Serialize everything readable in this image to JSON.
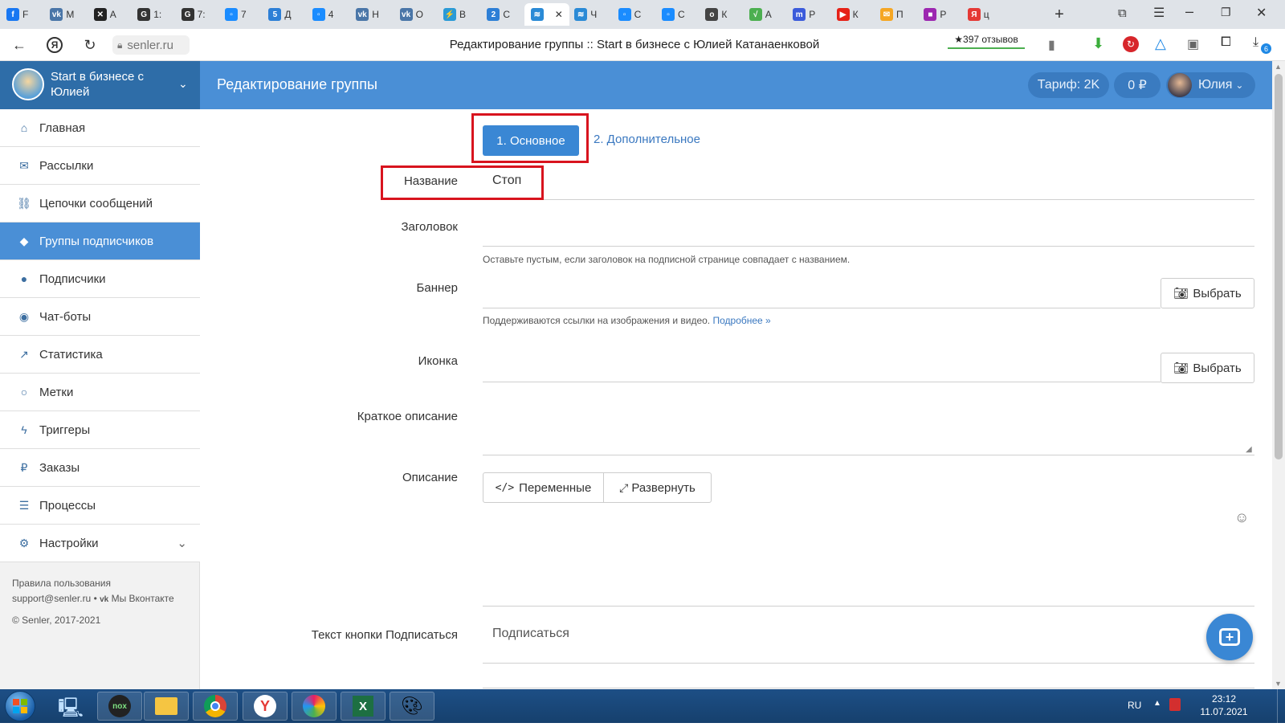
{
  "tabs": [
    {
      "label": "F",
      "icon": "facebook-icon",
      "color": "#1877f2",
      "glyph": "f"
    },
    {
      "label": "M",
      "icon": "vk-icon",
      "color": "#4a76a8",
      "glyph": "vk"
    },
    {
      "label": "A",
      "icon": "x-app-icon",
      "color": "#222",
      "glyph": "✕"
    },
    {
      "label": "1:",
      "icon": "gc-icon",
      "color": "#333",
      "glyph": "G"
    },
    {
      "label": "7:",
      "icon": "gc-icon",
      "color": "#333",
      "glyph": "G"
    },
    {
      "label": "7",
      "icon": "chat-icon",
      "color": "#1a8cff",
      "glyph": "▫"
    },
    {
      "label": "Д",
      "icon": "number5-icon",
      "color": "#2d7fd6",
      "glyph": "5"
    },
    {
      "label": "4",
      "icon": "chat-icon",
      "color": "#1a8cff",
      "glyph": "▫"
    },
    {
      "label": "Н",
      "icon": "vk-icon",
      "color": "#4a76a8",
      "glyph": "vk"
    },
    {
      "label": "О",
      "icon": "vk-icon",
      "color": "#4a76a8",
      "glyph": "vk"
    },
    {
      "label": "В",
      "icon": "runner-icon",
      "color": "#2a9ad6",
      "glyph": "⚡"
    },
    {
      "label": "С",
      "icon": "number2-icon",
      "color": "#2d7fd6",
      "glyph": "2"
    },
    {
      "label": "",
      "icon": "senler-icon",
      "color": "#2a8ad6",
      "glyph": "≋"
    },
    {
      "label": "Ч",
      "icon": "senler-icon",
      "color": "#2a8ad6",
      "glyph": "≋"
    },
    {
      "label": "С",
      "icon": "chat-icon",
      "color": "#1a8cff",
      "glyph": "▫"
    },
    {
      "label": "С",
      "icon": "chat-icon",
      "color": "#1a8cff",
      "glyph": "▫"
    },
    {
      "label": "К",
      "icon": "circle-icon",
      "color": "#444",
      "glyph": "o"
    },
    {
      "label": "А",
      "icon": "check-icon",
      "color": "#4caf50",
      "glyph": "√"
    },
    {
      "label": "Р",
      "icon": "m-app-icon",
      "color": "#3b5bdb",
      "glyph": "m"
    },
    {
      "label": "К",
      "icon": "youtube-icon",
      "color": "#e62117",
      "glyph": "▶"
    },
    {
      "label": "П",
      "icon": "mail-icon",
      "color": "#f5a623",
      "glyph": "✉"
    },
    {
      "label": "Р",
      "icon": "apps-icon",
      "color": "#9c27b0",
      "glyph": "■"
    },
    {
      "label": "ц",
      "icon": "yandex-icon",
      "color": "#e53935",
      "glyph": "Я"
    }
  ],
  "browser": {
    "url": "senler.ru",
    "page_title": "Редактирование группы :: Start в бизнесе с Юлией Катанаенковой",
    "reviews": "★397 отзывов",
    "download_badge": "6"
  },
  "app": {
    "group_name": "Start в бизнесе с Юлией",
    "header_title": "Редактирование группы",
    "tariff": "Тариф: 2K",
    "balance": "0 ₽",
    "user_name": "Юлия"
  },
  "sidebar": {
    "items": [
      {
        "label": "Главная",
        "icon": "home-icon",
        "glyph": "⌂"
      },
      {
        "label": "Рассылки",
        "icon": "envelope-icon",
        "glyph": "✉"
      },
      {
        "label": "Цепочки сообщений",
        "icon": "chain-icon",
        "glyph": "⛓"
      },
      {
        "label": "Группы подписчиков",
        "icon": "tags-icon",
        "glyph": "◆"
      },
      {
        "label": "Подписчики",
        "icon": "users-icon",
        "glyph": "●"
      },
      {
        "label": "Чат-боты",
        "icon": "android-icon",
        "glyph": "◉"
      },
      {
        "label": "Статистика",
        "icon": "chart-line-icon",
        "glyph": "↗"
      },
      {
        "label": "Метки",
        "icon": "circle-icon",
        "glyph": "○"
      },
      {
        "label": "Триггеры",
        "icon": "bolt-icon",
        "glyph": "ϟ"
      },
      {
        "label": "Заказы",
        "icon": "ruble-icon",
        "glyph": "₽"
      },
      {
        "label": "Процессы",
        "icon": "list-icon",
        "glyph": "☰"
      },
      {
        "label": "Настройки",
        "icon": "gears-icon",
        "glyph": "⚙"
      }
    ],
    "footer_terms": "Правила пользования",
    "footer_support": "support@senler.ru",
    "footer_sep": " • ",
    "footer_vk": "Мы Вконтакте",
    "footer_copy": "© Senler, 2017-2021"
  },
  "steps": {
    "step1": "1. Основное",
    "step2": "2. Дополнительное"
  },
  "form": {
    "name_label": "Название",
    "name_value": "Стоп",
    "title_label": "Заголовок",
    "title_help": "Оставьте пустым, если заголовок на подписной странице совпадает с названием.",
    "banner_label": "Баннер",
    "banner_help": "Поддерживаются ссылки на изображения и видео.",
    "banner_help_link": "Подробнее »",
    "pick_label": "Выбрать",
    "icon_label": "Иконка",
    "short_desc_label": "Краткое описание",
    "desc_label": "Описание",
    "variables_btn": "Переменные",
    "expand_btn": "Развернуть",
    "subscribe_label": "Текст кнопки Подписаться",
    "subscribe_value": "Подписаться"
  },
  "taskbar": {
    "lang": "RU",
    "time": "23:12",
    "date": "11.07.2021"
  }
}
